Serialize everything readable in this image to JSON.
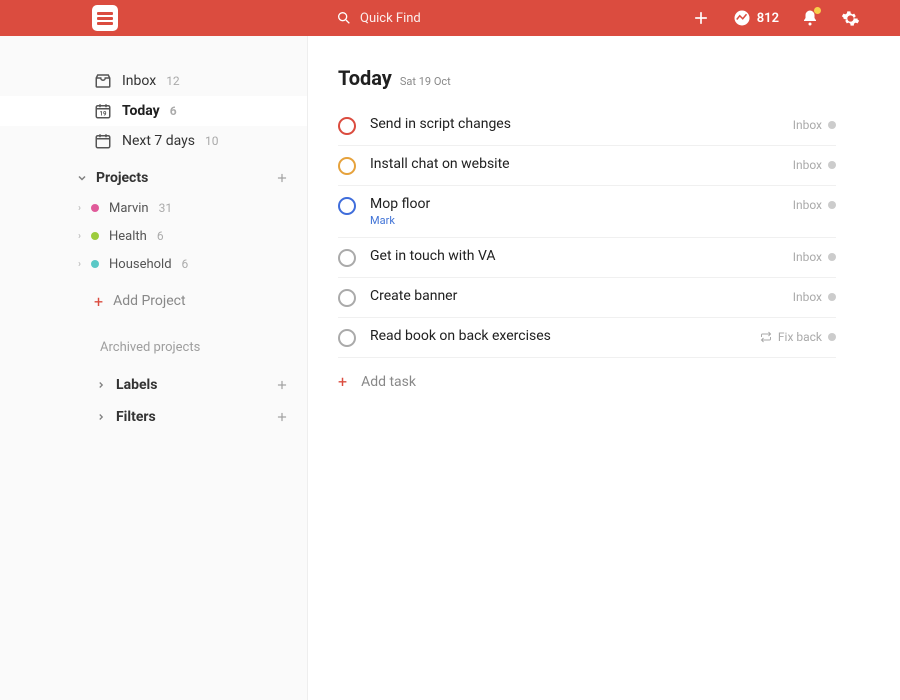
{
  "header": {
    "search_placeholder": "Quick Find",
    "karma_points": "812"
  },
  "sidebar": {
    "nav": [
      {
        "label": "Inbox",
        "count": "12",
        "icon": "inbox"
      },
      {
        "label": "Today",
        "count": "6",
        "icon": "today",
        "selected": true
      },
      {
        "label": "Next 7 days",
        "count": "10",
        "icon": "next7"
      }
    ],
    "projects_title": "Projects",
    "projects": [
      {
        "name": "Marvin",
        "count": "31",
        "color": "#e05b9a"
      },
      {
        "name": "Health",
        "count": "6",
        "color": "#9ccc3c"
      },
      {
        "name": "Household",
        "count": "6",
        "color": "#5ac8c6"
      }
    ],
    "add_project": "Add Project",
    "archived": "Archived projects",
    "labels_title": "Labels",
    "filters_title": "Filters"
  },
  "main": {
    "title": "Today",
    "date": "Sat 19 Oct",
    "tasks": [
      {
        "title": "Send in script changes",
        "project": "Inbox",
        "ring": "#db4c3f"
      },
      {
        "title": "Install chat on website",
        "project": "Inbox",
        "ring": "#e6a23c"
      },
      {
        "title": "Mop floor",
        "project": "Inbox",
        "ring": "#3f6ddb",
        "sub": "Mark"
      },
      {
        "title": "Get in touch with VA",
        "project": "Inbox",
        "ring": "#aaaaaa"
      },
      {
        "title": "Create banner",
        "project": "Inbox",
        "ring": "#aaaaaa"
      },
      {
        "title": "Read book on back exercises",
        "project": "Fix back",
        "ring": "#aaaaaa",
        "recurring": true
      }
    ],
    "add_task": "Add task"
  }
}
